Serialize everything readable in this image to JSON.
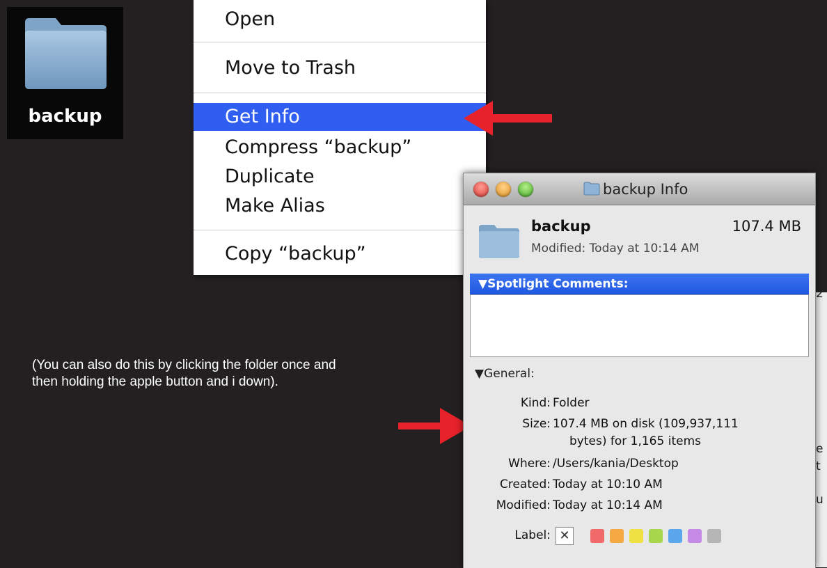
{
  "folder": {
    "label": "backup"
  },
  "context_menu": {
    "items": [
      {
        "label": "Open"
      },
      {
        "label": "Move to Trash"
      },
      {
        "label": "Get Info"
      },
      {
        "label": "Compress “backup”"
      },
      {
        "label": "Duplicate"
      },
      {
        "label": "Make Alias"
      },
      {
        "label": "Copy “backup”"
      }
    ],
    "highlight_color": "#2f5ef0"
  },
  "arrow_color": "#e8222a",
  "info_window": {
    "title": "backup Info",
    "name": "backup",
    "size": "107.4 MB",
    "modified_line": "Modified: Today at 10:14 AM",
    "spotlight_label": "▼Spotlight Comments:",
    "general_label": "▼General:",
    "general": {
      "kind_key": "Kind:",
      "kind": "Folder",
      "size_key": "Size:",
      "size_line1": "107.4 MB on disk (109,937,111",
      "size_line2": "bytes) for 1,165 items",
      "where_key": "Where:",
      "where": "/Users/kania/Desktop",
      "created_key": "Created:",
      "created": "Today at 10:10 AM",
      "modified_key": "Modified:",
      "modified": "Today at 10:14 AM",
      "label_key": "Label:",
      "label_none": "✕"
    },
    "label_colors": [
      "#f06a6a",
      "#f4a945",
      "#efe043",
      "#a8d74e",
      "#5aa7ee",
      "#c58ae6",
      "#b5b5b5"
    ]
  },
  "background_window_fragments": [
    "e",
    "t",
    "u",
    "2"
  ],
  "tip": "(You can also do this by clicking the folder once and then holding the apple button and i down)."
}
